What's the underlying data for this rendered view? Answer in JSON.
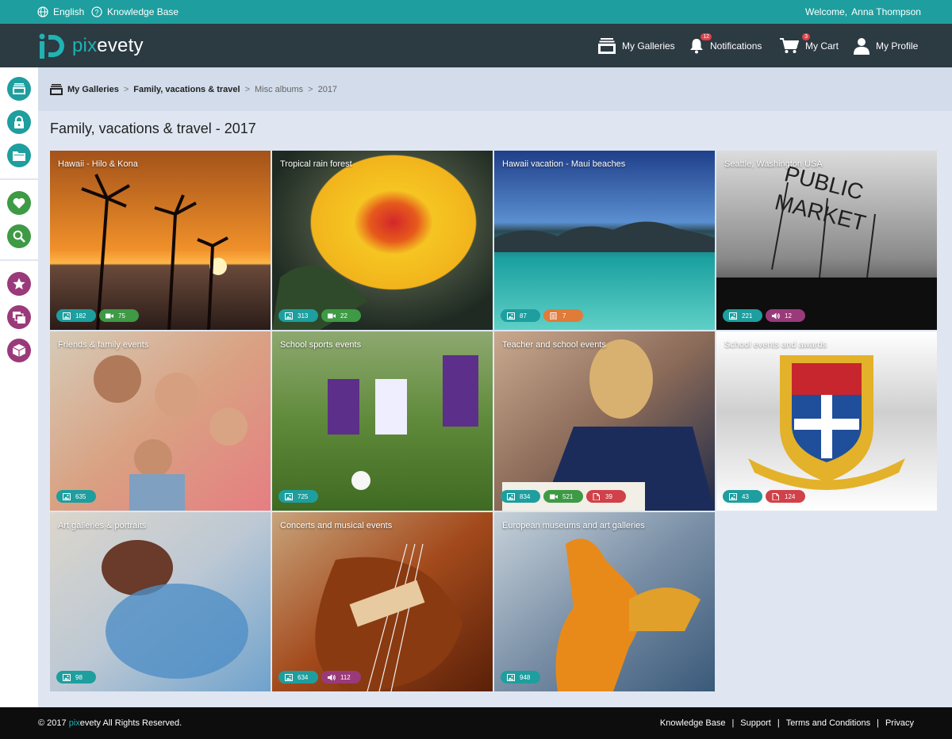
{
  "topbar": {
    "language": "English",
    "knowledge_base": "Knowledge Base",
    "welcome": "Welcome,",
    "user_name": "Anna Thompson"
  },
  "header": {
    "logo_pix": "pix",
    "logo_evety": "evety",
    "nav": {
      "galleries": "My Galleries",
      "notifications": "Notifications",
      "notifications_count": "12",
      "cart": "My Cart",
      "cart_count": "3",
      "profile": "My Profile"
    }
  },
  "breadcrumb": {
    "root": "My Galleries",
    "level1": "Family, vacations & travel",
    "level2": "Misc albums",
    "level3": "2017",
    "sep": ">"
  },
  "page": {
    "title": "Family, vacations & travel - 2017"
  },
  "albums": [
    {
      "title": "Hawaii - Hilo & Kona",
      "counts": [
        {
          "kind": "photos",
          "value": "182",
          "color": "#1e9e9e"
        },
        {
          "kind": "videos",
          "value": "75",
          "color": "#3e9a45"
        }
      ]
    },
    {
      "title": "Tropical rain forest",
      "counts": [
        {
          "kind": "photos",
          "value": "313",
          "color": "#1e9e9e"
        },
        {
          "kind": "videos",
          "value": "22",
          "color": "#3e9a45"
        }
      ]
    },
    {
      "title": "Hawaii vacation - Maui beaches",
      "counts": [
        {
          "kind": "photos",
          "value": "87",
          "color": "#1e9e9e"
        },
        {
          "kind": "books",
          "value": "7",
          "color": "#e07b3a"
        }
      ]
    },
    {
      "title": "Seattle, Washington USA",
      "counts": [
        {
          "kind": "photos",
          "value": "221",
          "color": "#1e9e9e"
        },
        {
          "kind": "audio",
          "value": "12",
          "color": "#9a3a7a"
        }
      ]
    },
    {
      "title": "Friends & family events",
      "counts": [
        {
          "kind": "photos",
          "value": "635",
          "color": "#1e9e9e"
        }
      ]
    },
    {
      "title": "School sports events",
      "counts": [
        {
          "kind": "photos",
          "value": "725",
          "color": "#1e9e9e"
        }
      ]
    },
    {
      "title": "Teacher and school events",
      "counts": [
        {
          "kind": "photos",
          "value": "834",
          "color": "#1e9e9e"
        },
        {
          "kind": "videos",
          "value": "521",
          "color": "#3e9a45"
        },
        {
          "kind": "documents",
          "value": "39",
          "color": "#d04149"
        }
      ]
    },
    {
      "title": "School events and awards",
      "counts": [
        {
          "kind": "photos",
          "value": "43",
          "color": "#1e9e9e"
        },
        {
          "kind": "documents",
          "value": "124",
          "color": "#d04149"
        }
      ]
    },
    {
      "title": "Art galleries & portraits",
      "counts": [
        {
          "kind": "photos",
          "value": "98",
          "color": "#1e9e9e"
        }
      ]
    },
    {
      "title": "Concerts and musical events",
      "counts": [
        {
          "kind": "photos",
          "value": "634",
          "color": "#1e9e9e"
        },
        {
          "kind": "audio",
          "value": "112",
          "color": "#9a3a7a"
        }
      ]
    },
    {
      "title": "European museums and art galleries",
      "counts": [
        {
          "kind": "photos",
          "value": "948",
          "color": "#1e9e9e"
        }
      ]
    }
  ],
  "sidebar_icons": [
    "gallery-icon",
    "lock-icon",
    "folder-icon",
    "heart-icon",
    "search-icon",
    "star-icon",
    "gallery-stack-icon",
    "box-icon"
  ],
  "footer": {
    "copyright_prefix": "© 2017",
    "pix": "pix",
    "rest": "evety All Rights Reserved.",
    "links": [
      "Knowledge Base",
      "Support",
      "Terms and Conditions",
      "Privacy"
    ],
    "sep": "|"
  }
}
